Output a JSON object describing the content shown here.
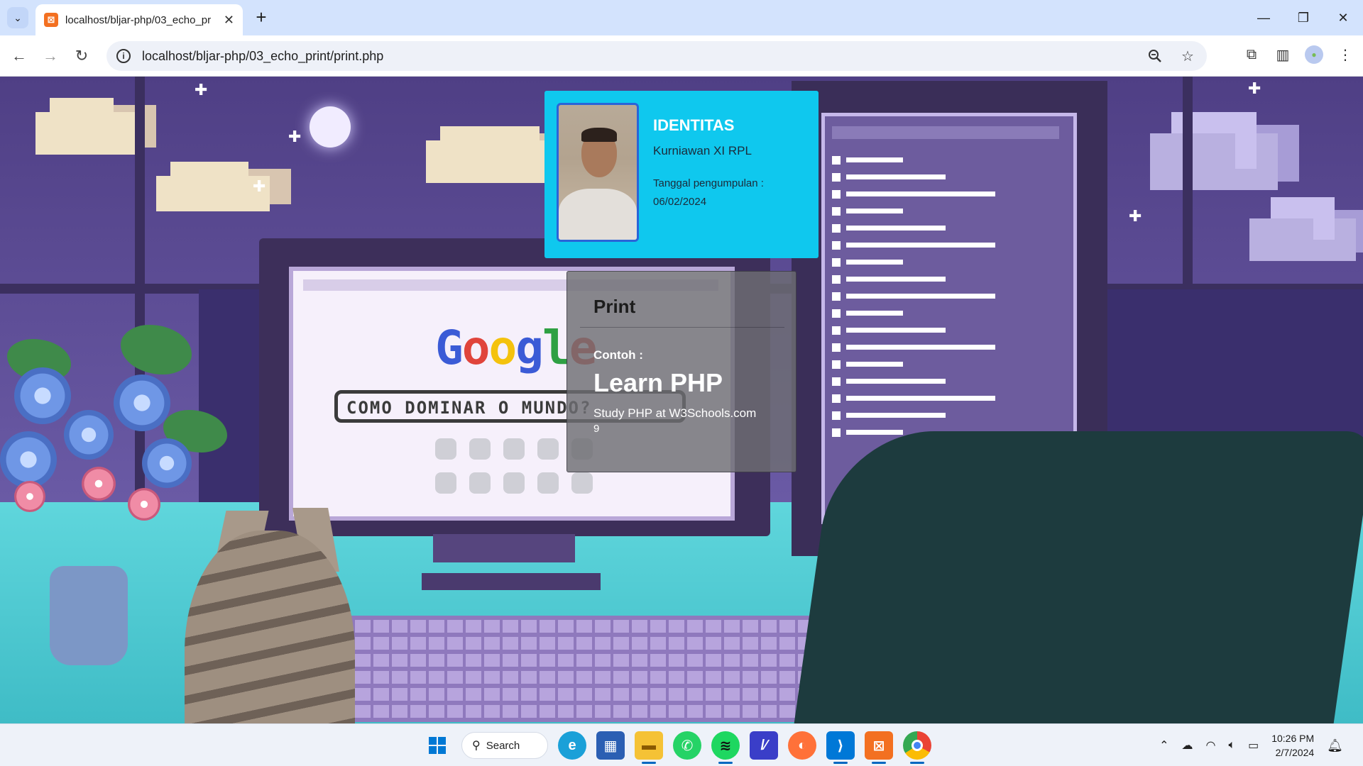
{
  "browser": {
    "tab_title": "localhost/bljar-php/03_echo_pr",
    "tab_favicon": "xampp-icon",
    "url": "localhost/bljar-php/03_echo_print/print.php",
    "new_tab_symbol": "+",
    "close_symbol": "✕"
  },
  "window_controls": {
    "minimize": "—",
    "restore": "❐",
    "close": "✕"
  },
  "identitas": {
    "title": "IDENTITAS",
    "name": "Kurniawan XI RPL",
    "date_label": "Tanggal pengumpulan :",
    "date": "06/02/2024"
  },
  "print_card": {
    "title": "Print",
    "contoh_label": "Contoh :",
    "heading": "Learn PHP",
    "line1": "Study PHP at W3Schools.com",
    "line2": "9"
  },
  "background_art": {
    "monitor_logo": "Google",
    "monitor_search_text": "COMO DOMINAR O MUNDO?"
  },
  "taskbar": {
    "search_label": "Search",
    "apps": [
      "windows-start-icon",
      "edge-icon",
      "store-icon",
      "file-explorer-icon",
      "whatsapp-icon",
      "spotify-icon",
      "editor-icon",
      "firefox-icon",
      "vscode-icon",
      "xampp-icon",
      "chrome-icon"
    ],
    "time": "10:26 PM",
    "date": "2/7/2024"
  },
  "colors": {
    "id_card_bg": "#0fc8ee",
    "print_card_bg": "#6e6e73",
    "tabbar_bg": "#d3e3fd"
  }
}
